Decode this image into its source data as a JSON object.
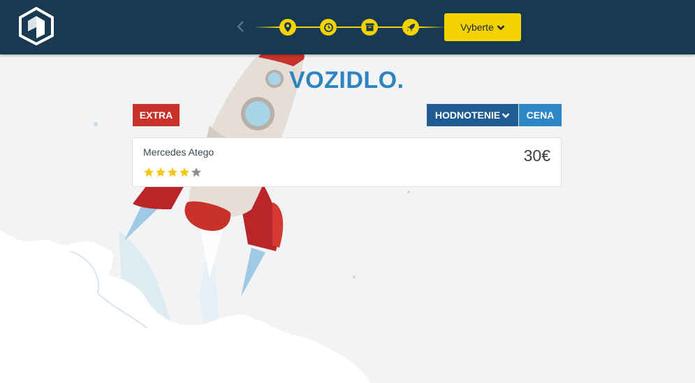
{
  "header": {
    "select_label": "Vyberte",
    "steps": [
      {
        "icon": "map-pin-icon"
      },
      {
        "icon": "clock-icon"
      },
      {
        "icon": "archive-box-icon"
      },
      {
        "icon": "rocket-icon"
      }
    ]
  },
  "main": {
    "title": "VOZIDLO.",
    "filter_extra": "EXTRA",
    "sort_rating": "HODNOTENIE",
    "sort_price": "CENA"
  },
  "vehicles": [
    {
      "name": "Mercedes Atego",
      "price": "30€",
      "rating": 4,
      "max_rating": 5
    }
  ],
  "colors": {
    "header_bg": "#173a52",
    "accent_yellow": "#f2d300",
    "title_blue": "#2d84c0",
    "extra_red": "#c8322a",
    "rating_blue": "#1f5c93",
    "price_blue": "#2f86c6"
  }
}
